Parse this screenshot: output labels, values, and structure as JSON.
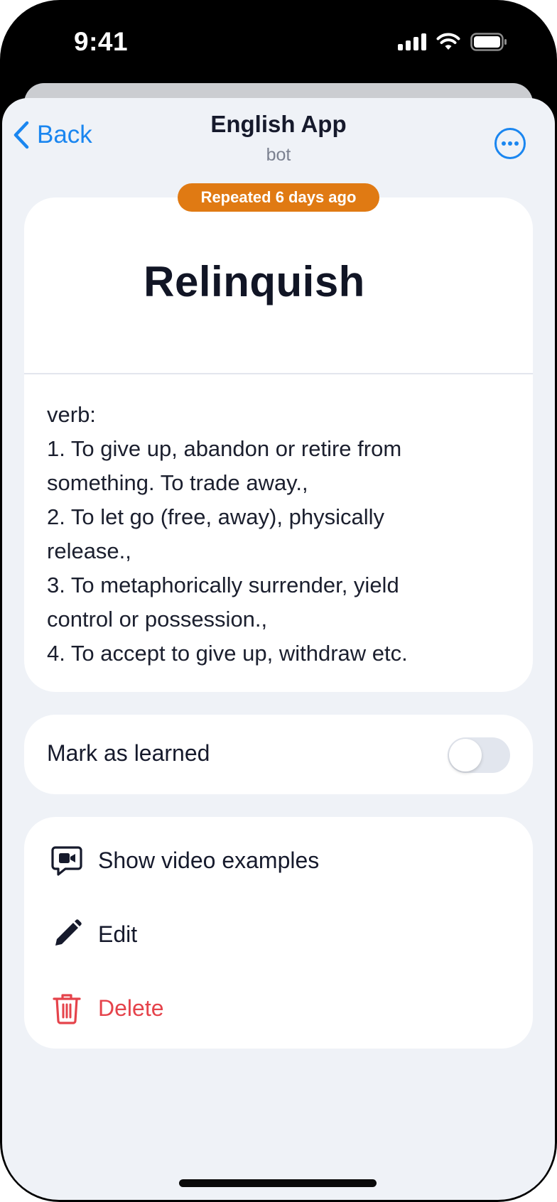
{
  "status_bar": {
    "time": "9:41"
  },
  "nav": {
    "back_label": "Back",
    "title": "English App",
    "subtitle": "bot"
  },
  "badge": {
    "text": "Repeated 6 days ago"
  },
  "word_card": {
    "word": "Relinquish",
    "definition_lines": [
      "verb:",
      "1. To give up, abandon or retire from",
      "something. To trade away.,",
      "2. To let go (free, away), physically",
      "release.,",
      "3. To metaphorically surrender, yield",
      "control or possession.,",
      "4. To accept to give up, withdraw etc."
    ]
  },
  "learned": {
    "label": "Mark as learned",
    "toggle_on": false
  },
  "actions": [
    {
      "label": "Show video examples",
      "icon": "video-chat-icon"
    },
    {
      "label": "Edit",
      "icon": "pencil-icon"
    },
    {
      "label": "Delete",
      "icon": "trash-icon"
    }
  ],
  "colors": {
    "accent": "#1a86f0",
    "badge": "#e07a13",
    "danger": "#e5434b",
    "background": "#eff2f7",
    "text": "#161a2c"
  }
}
